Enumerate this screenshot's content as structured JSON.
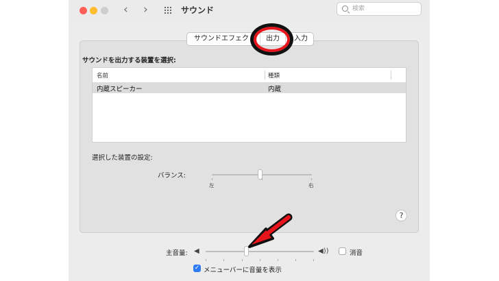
{
  "window": {
    "title": "サウンド"
  },
  "toolbar": {
    "back_icon": "chevron-left-icon",
    "forward_icon": "chevron-right-icon",
    "grid_icon": "grid-icon",
    "back_glyph": "‹",
    "forward_glyph": "›"
  },
  "search": {
    "placeholder": "検索",
    "value": ""
  },
  "tabs": [
    {
      "label": "サウンドエフェクト",
      "selected": false
    },
    {
      "label": "出力",
      "selected": true
    },
    {
      "label": "入力",
      "selected": false
    }
  ],
  "output": {
    "heading": "サウンドを出力する装置を選択:",
    "table": {
      "columns": [
        "名前",
        "種類"
      ],
      "rows": [
        {
          "name": "内蔵スピーカー",
          "type": "内蔵",
          "selected": true
        }
      ]
    },
    "selected_device_heading": "選択した装置の設定:",
    "balance": {
      "label": "バランス:",
      "left": "左",
      "right": "右",
      "value": 0.5
    }
  },
  "help": {
    "label": "?"
  },
  "volume": {
    "label": "主音量:",
    "low_icon": "speaker-low-icon",
    "high_icon": "speaker-high-icon",
    "low_glyph": "◀",
    "high_glyph": "◀))",
    "value": 0.38,
    "mute_label": "消音",
    "mute_checked": false
  },
  "menubar": {
    "label": "メニューバーに音量を表示",
    "checked": true,
    "check_glyph": "✓"
  },
  "annotations": {
    "color": "#e8141b"
  }
}
